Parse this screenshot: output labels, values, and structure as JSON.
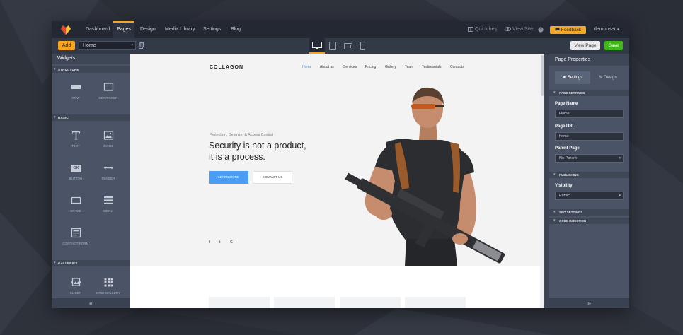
{
  "colors": {
    "accent": "#f5a623",
    "save": "#3fb618",
    "link_active": "#3b8ef0",
    "panel": "#4b5466",
    "topnav": "#232833"
  },
  "topnav": {
    "items": [
      {
        "label": "Dashboard"
      },
      {
        "label": "Pages"
      },
      {
        "label": "Design"
      },
      {
        "label": "Media Library"
      },
      {
        "label": "Settings"
      },
      {
        "label": "Blog"
      }
    ],
    "active": "Pages",
    "quick_help": "Quick help",
    "view_site": "View Site",
    "feedback": "Feedback",
    "user": "demouser"
  },
  "toolbar": {
    "add_label": "Add",
    "page_select_value": "Home",
    "view_page_label": "View Page",
    "save_label": "Save",
    "devices": [
      "desktop-icon",
      "tablet-icon",
      "tablet-landscape-icon",
      "mobile-icon"
    ]
  },
  "widgets_panel": {
    "title": "Widgets",
    "sections": [
      {
        "name": "STRUCTURE",
        "items": [
          {
            "label": "ROW",
            "icon": "row-icon"
          },
          {
            "label": "CONTAINER",
            "icon": "container-icon"
          }
        ]
      },
      {
        "name": "BASIC",
        "items": [
          {
            "label": "TEXT",
            "icon": "text-icon"
          },
          {
            "label": "IMAGE",
            "icon": "image-icon"
          },
          {
            "label": "BUTTON",
            "icon": "button-icon"
          },
          {
            "label": "DIVIDER",
            "icon": "divider-icon"
          },
          {
            "label": "SPACE",
            "icon": "space-icon"
          },
          {
            "label": "MENU",
            "icon": "menu-icon"
          },
          {
            "label": "CONTACT FORM",
            "icon": "contact-form-icon"
          }
        ]
      },
      {
        "name": "GALLERIES",
        "items": [
          {
            "label": "SLIDER",
            "icon": "slider-icon"
          },
          {
            "label": "GRID GALLERY",
            "icon": "grid-gallery-icon"
          }
        ]
      }
    ],
    "button_icon_text": "OK",
    "collapse": "«"
  },
  "preview": {
    "brand": "COLLAGON",
    "nav": [
      {
        "label": "Home"
      },
      {
        "label": "About us"
      },
      {
        "label": "Services"
      },
      {
        "label": "Pricing"
      },
      {
        "label": "Gallery"
      },
      {
        "label": "Team"
      },
      {
        "label": "Testimonials"
      },
      {
        "label": "Contacts"
      }
    ],
    "tagline": "Protection, Defense, & Access Control",
    "headline_1": "Security is not a product,",
    "headline_2": "it is a process.",
    "learn_more": "LEARN MORE",
    "contact_us": "CONTACT US",
    "social": [
      "f",
      "t",
      "G+"
    ]
  },
  "properties_panel": {
    "title": "Page Properties",
    "tab_settings": "Settings",
    "tab_design": "Design",
    "sec_page_settings": "PAGE SETTINGS",
    "page_name_label": "Page Name",
    "page_name_value": "Home",
    "page_url_label": "Page URL",
    "page_url_value": "home",
    "parent_page_label": "Parent Page",
    "parent_page_value": "No Parent",
    "sec_publishing": "PUBLISHING",
    "visibility_label": "Visibility",
    "visibility_value": "Public",
    "sec_seo": "SEO SETTINGS",
    "sec_code": "CODE INJECTION",
    "collapse": "»"
  }
}
